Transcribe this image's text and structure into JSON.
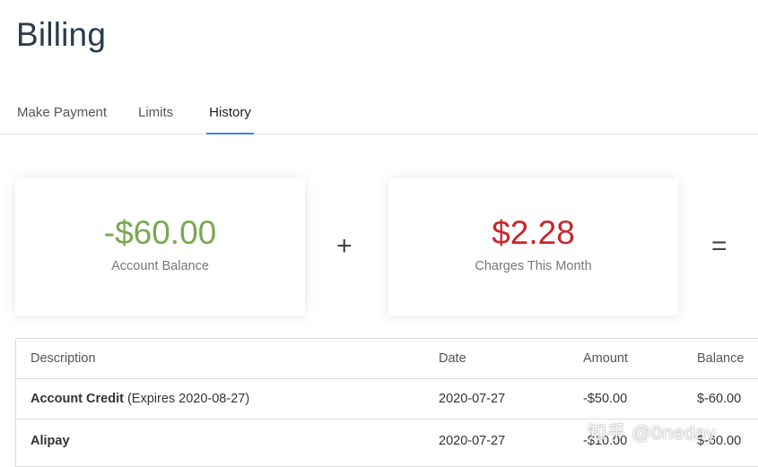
{
  "page": {
    "title": "Billing"
  },
  "tabs": [
    {
      "label": "Make Payment",
      "active": false
    },
    {
      "label": "Limits",
      "active": false
    },
    {
      "label": "History",
      "active": true
    }
  ],
  "summary": {
    "balance": {
      "value": "-$60.00",
      "label": "Account Balance",
      "color": "#7aa84f"
    },
    "plus": "+",
    "charges": {
      "value": "$2.28",
      "label": "Charges This Month",
      "color": "#c8262a"
    },
    "equals": "="
  },
  "table": {
    "headers": {
      "description": "Description",
      "date": "Date",
      "amount": "Amount",
      "balance": "Balance"
    },
    "rows": [
      {
        "title": "Account Credit",
        "note": " (Expires 2020-08-27)",
        "date": "2020-07-27",
        "amount": "-$50.00",
        "balance": "$-60.00"
      },
      {
        "title": "Alipay",
        "note": "",
        "date": "2020-07-27",
        "amount": "-$10.00",
        "balance": "$-60.00"
      }
    ]
  },
  "watermark": "知乎 @0neday",
  "colors": {
    "accent": "#3a87d8"
  }
}
